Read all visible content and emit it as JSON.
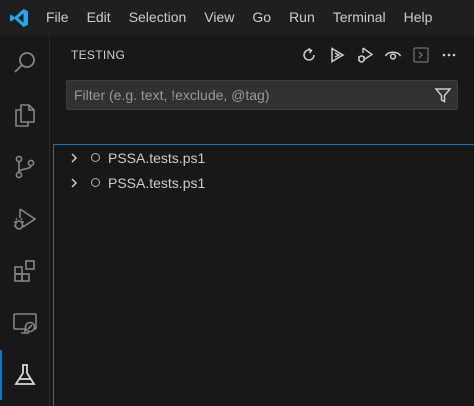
{
  "app": {
    "logo_icon": "vscode-logo-icon",
    "accent": "#0078d4"
  },
  "menu": {
    "items": [
      {
        "label": "File"
      },
      {
        "label": "Edit"
      },
      {
        "label": "Selection"
      },
      {
        "label": "View"
      },
      {
        "label": "Go"
      },
      {
        "label": "Run"
      },
      {
        "label": "Terminal"
      },
      {
        "label": "Help"
      }
    ]
  },
  "activity_bar": {
    "items": [
      {
        "icon": "search-icon"
      },
      {
        "icon": "explorer-files-icon"
      },
      {
        "icon": "source-control-icon"
      },
      {
        "icon": "run-debug-icon"
      },
      {
        "icon": "extensions-icon"
      },
      {
        "icon": "remote-explorer-icon"
      },
      {
        "icon": "testing-beaker-icon",
        "active": true
      }
    ]
  },
  "sidebar": {
    "title": "TESTING",
    "toolbar": [
      {
        "icon": "refresh-icon"
      },
      {
        "icon": "run-all-tests-icon"
      },
      {
        "icon": "debug-all-tests-icon"
      },
      {
        "icon": "watch-eye-icon"
      },
      {
        "icon": "show-output-icon"
      },
      {
        "icon": "more-actions-icon"
      }
    ],
    "filter": {
      "placeholder": "Filter (e.g. text, !exclude, @tag)",
      "value": ""
    },
    "tree": [
      {
        "label": "PSSA.tests.ps1"
      },
      {
        "label": "PSSA.tests.ps1"
      }
    ]
  }
}
